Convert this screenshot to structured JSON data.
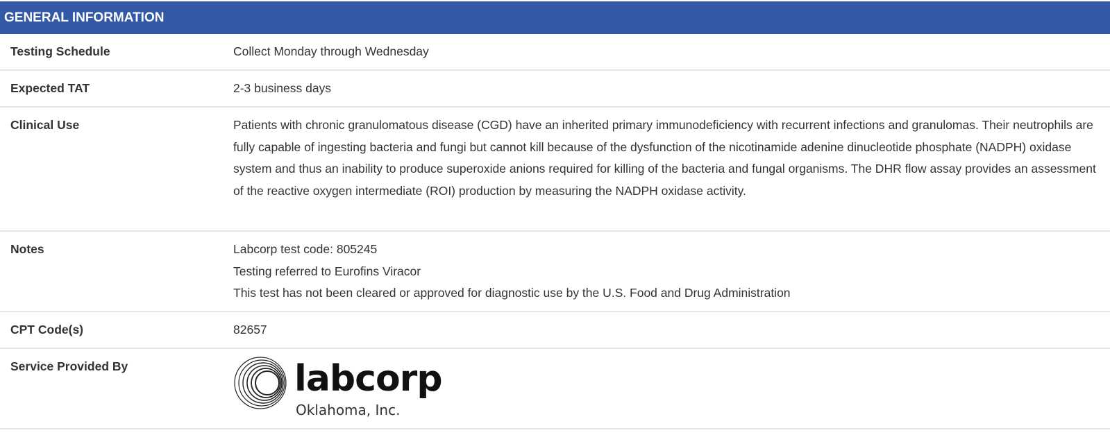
{
  "header": {
    "title": "GENERAL INFORMATION"
  },
  "rows": {
    "schedule": {
      "label": "Testing Schedule",
      "value": "Collect Monday through Wednesday"
    },
    "tat": {
      "label": "Expected TAT",
      "value": "2-3 business days"
    },
    "clinical": {
      "label": "Clinical Use",
      "value": "Patients with chronic granulomatous disease (CGD) have an inherited primary immunodeficiency with recurrent infections and granulomas. Their neutrophils are fully capable of ingesting bacteria and fungi but cannot kill because of the dysfunction of the nicotinamide adenine dinucleotide phosphate (NADPH) oxidase system and thus an inability to produce superoxide anions required for killing of the bacteria and fungal organisms. The DHR flow assay provides an assessment of the reactive oxygen intermediate (ROI) production by measuring the NADPH oxidase activity."
    },
    "notes": {
      "label": "Notes",
      "lines": [
        "Labcorp test code: 805245",
        "Testing referred to Eurofins Viracor",
        "This test has not been cleared or approved for diagnostic use by the U.S. Food and Drug Administration"
      ]
    },
    "cpt": {
      "label": "CPT Code(s)",
      "value": "82657"
    },
    "service": {
      "label": "Service Provided By",
      "logo": {
        "icon": "labcorp-rings-logo-icon",
        "wordmark": "labcorp",
        "subtitle": "Oklahoma, Inc."
      }
    }
  },
  "colors": {
    "header_bg": "#3358a5",
    "header_text": "#ffffff",
    "divider": "#e6e6e6",
    "text": "#333333"
  }
}
